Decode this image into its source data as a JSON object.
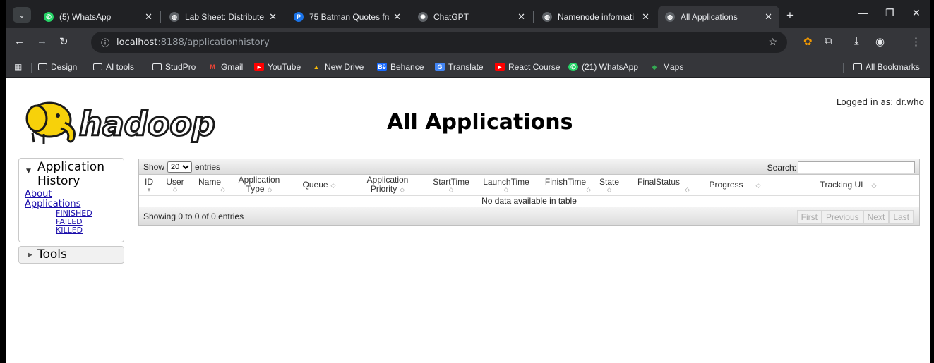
{
  "browser": {
    "tabs": [
      {
        "title": "(5) WhatsApp",
        "icon": "whatsapp-icon",
        "color": "#25d366"
      },
      {
        "title": "Lab Sheet: Distribute",
        "icon": "globe-icon",
        "color": "#5f6368"
      },
      {
        "title": "75 Batman Quotes fro",
        "icon": "p-logo-icon",
        "color": "#1a73e8"
      },
      {
        "title": "ChatGPT",
        "icon": "openai-icon",
        "color": "#5f6368"
      },
      {
        "title": "Namenode informati",
        "icon": "globe-icon",
        "color": "#5f6368"
      },
      {
        "title": "All Applications",
        "icon": "globe-icon",
        "color": "#5f6368"
      }
    ],
    "url_host": "localhost",
    "url_path": ":8188/applicationhistory",
    "bookmarks": [
      {
        "label": "Design",
        "icon": "folder-icon"
      },
      {
        "label": "AI tools",
        "icon": "folder-icon"
      },
      {
        "label": "StudPro",
        "icon": "folder-icon"
      },
      {
        "label": "Gmail",
        "icon": "gmail-icon"
      },
      {
        "label": "YouTube",
        "icon": "youtube-icon"
      },
      {
        "label": "New Drive",
        "icon": "drive-icon"
      },
      {
        "label": "Behance",
        "icon": "behance-icon"
      },
      {
        "label": "Translate",
        "icon": "translate-icon"
      },
      {
        "label": "React Course",
        "icon": "youtube-icon"
      },
      {
        "label": "(21) WhatsApp",
        "icon": "whatsapp-icon"
      },
      {
        "label": "Maps",
        "icon": "maps-icon"
      }
    ],
    "all_bookmarks": "All Bookmarks"
  },
  "page": {
    "title": "All Applications",
    "logged_in": "Logged in as: dr.who",
    "logo_text": "hadoop"
  },
  "nav": {
    "section_title": "Application History",
    "links": [
      "About",
      "Applications"
    ],
    "sub_links": [
      "FINISHED",
      "FAILED",
      "KILLED"
    ],
    "tools": "Tools"
  },
  "table": {
    "show_label": "Show",
    "page_size": "20",
    "entries_label": "entries",
    "search_label": "Search:",
    "columns": [
      "ID",
      "User",
      "Name",
      "Application Type",
      "Queue",
      "Application Priority",
      "StartTime",
      "LaunchTime",
      "FinishTime",
      "State",
      "FinalStatus",
      "Progress",
      "Tracking UI"
    ],
    "empty_message": "No data available in table",
    "info": "Showing 0 to 0 of 0 entries",
    "pager": [
      "First",
      "Previous",
      "Next",
      "Last"
    ]
  }
}
